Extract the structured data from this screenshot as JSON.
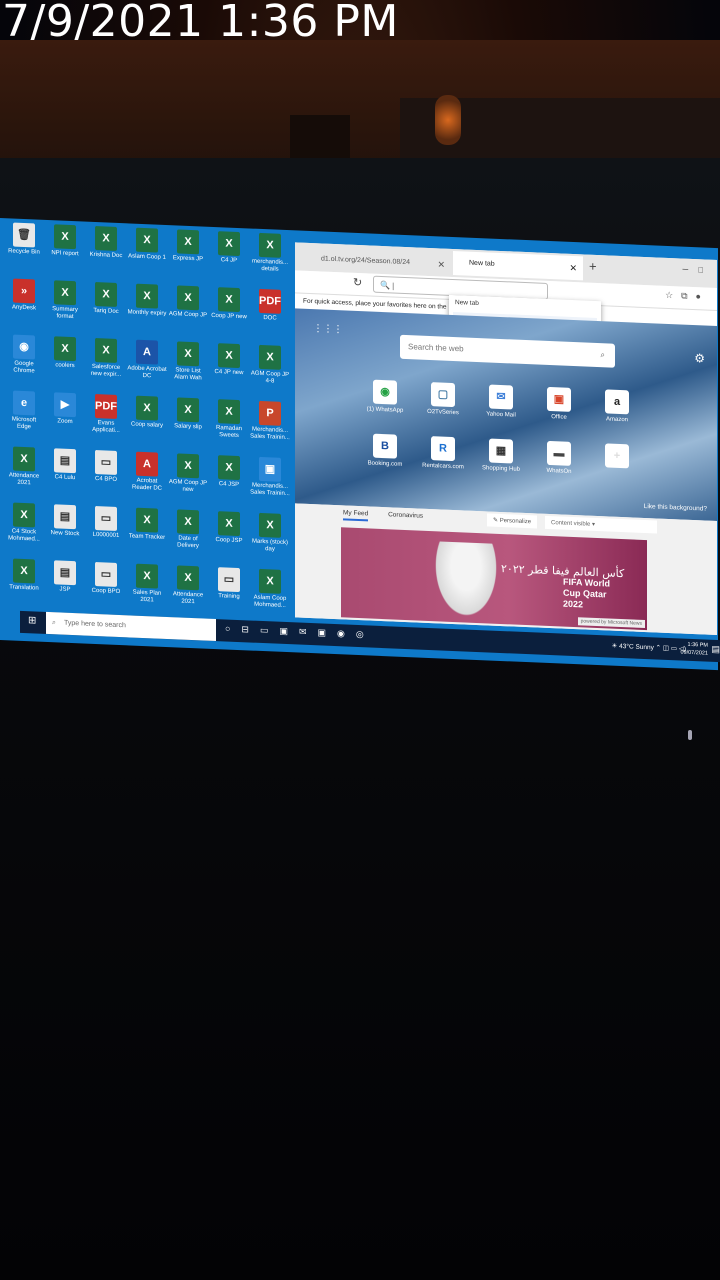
{
  "timestamp": "7/9/2021 1:36 PM",
  "desktop_icons": [
    {
      "label": "Recycle Bin",
      "kind": "w",
      "glyph": "🗑"
    },
    {
      "label": "NPI report",
      "kind": "x",
      "glyph": "X"
    },
    {
      "label": "Krishna Doc",
      "kind": "x",
      "glyph": "X"
    },
    {
      "label": "Aslam Coop 1",
      "kind": "x",
      "glyph": "X"
    },
    {
      "label": "Express JP",
      "kind": "x",
      "glyph": "X"
    },
    {
      "label": "C4 JP",
      "kind": "x",
      "glyph": "X"
    },
    {
      "label": "merchandis... details",
      "kind": "x",
      "glyph": "X"
    },
    {
      "label": "AnyDesk",
      "kind": "p",
      "glyph": "»"
    },
    {
      "label": "Summary format",
      "kind": "x",
      "glyph": "X"
    },
    {
      "label": "Tariq Doc",
      "kind": "x",
      "glyph": "X"
    },
    {
      "label": "Monthly expiry",
      "kind": "x",
      "glyph": "X"
    },
    {
      "label": "AGM Coop JP",
      "kind": "x",
      "glyph": "X"
    },
    {
      "label": "Coop JP new",
      "kind": "x",
      "glyph": "X"
    },
    {
      "label": "DOC",
      "kind": "p",
      "glyph": "PDF"
    },
    {
      "label": "Google Chrome",
      "kind": "e",
      "glyph": "◉"
    },
    {
      "label": "coolers",
      "kind": "x",
      "glyph": "X"
    },
    {
      "label": "Salesforce new expir...",
      "kind": "x",
      "glyph": "X"
    },
    {
      "label": "Adobe Acrobat DC",
      "kind": "b",
      "glyph": "A"
    },
    {
      "label": "Store List Alam Wah",
      "kind": "x",
      "glyph": "X"
    },
    {
      "label": "C4 JP new",
      "kind": "x",
      "glyph": "X"
    },
    {
      "label": "AGM Coop JP 4-8",
      "kind": "x",
      "glyph": "X"
    },
    {
      "label": "Microsoft Edge",
      "kind": "e",
      "glyph": "e"
    },
    {
      "label": "Zoom",
      "kind": "e",
      "glyph": "▶"
    },
    {
      "label": "Evans Applicati...",
      "kind": "p",
      "glyph": "PDF"
    },
    {
      "label": "Coop salary",
      "kind": "x",
      "glyph": "X"
    },
    {
      "label": "Salary slip",
      "kind": "x",
      "glyph": "X"
    },
    {
      "label": "Ramadan Sweets",
      "kind": "x",
      "glyph": "X"
    },
    {
      "label": "Merchandis... Sales Trainin...",
      "kind": "pp",
      "glyph": "P"
    },
    {
      "label": "Attendance 2021",
      "kind": "x",
      "glyph": "X"
    },
    {
      "label": "C4 Lulu",
      "kind": "w",
      "glyph": "▤"
    },
    {
      "label": "C4 BPO",
      "kind": "w",
      "glyph": "▭"
    },
    {
      "label": "Acrobat Reader DC",
      "kind": "p",
      "glyph": "A"
    },
    {
      "label": "AGM Coop JP new",
      "kind": "x",
      "glyph": "X"
    },
    {
      "label": "C4 JSP",
      "kind": "x",
      "glyph": "X"
    },
    {
      "label": "Merchandis... Sales Trainin...",
      "kind": "e",
      "glyph": "▣"
    },
    {
      "label": "C4 Stock Mohmaed...",
      "kind": "x",
      "glyph": "X"
    },
    {
      "label": "New Stock",
      "kind": "w",
      "glyph": "▤"
    },
    {
      "label": "L0000001",
      "kind": "w",
      "glyph": "▭"
    },
    {
      "label": "Team Tracker",
      "kind": "x",
      "glyph": "X"
    },
    {
      "label": "Date of Delivery",
      "kind": "x",
      "glyph": "X"
    },
    {
      "label": "Coop JSP",
      "kind": "x",
      "glyph": "X"
    },
    {
      "label": "Marks (stock) day",
      "kind": "x",
      "glyph": "X"
    },
    {
      "label": "Translation",
      "kind": "x",
      "glyph": "X"
    },
    {
      "label": "JSP",
      "kind": "w",
      "glyph": "▤"
    },
    {
      "label": "Coop BPO",
      "kind": "w",
      "glyph": "▭"
    },
    {
      "label": "Sales Plan 2021",
      "kind": "x",
      "glyph": "X"
    },
    {
      "label": "Attendance 2021",
      "kind": "x",
      "glyph": "X"
    },
    {
      "label": "Training",
      "kind": "w",
      "glyph": "▭"
    },
    {
      "label": "Aslam Coop Mohmaed...",
      "kind": "x",
      "glyph": "X"
    }
  ],
  "browser": {
    "tab1_title": "d1.ol.tv.org/24/Season.08/24",
    "tab2_title": "New tab",
    "new_tab_glyph": "+",
    "dropdown_title": "New tab",
    "dropdown_url": "edge://newtab",
    "favorites_hint": "For quick access, place your favorites here on the",
    "search_placeholder": "Search the web",
    "tiles": [
      {
        "name": "(1) WhatsApp",
        "glyph": "◉",
        "color": "#25a244"
      },
      {
        "name": "O2TvSeries",
        "glyph": "▢",
        "color": "#4a7fa8"
      },
      {
        "name": "Yahoo Mail",
        "glyph": "✉",
        "color": "#3d7fd8"
      },
      {
        "name": "Office",
        "glyph": "▣",
        "color": "#d8452a"
      },
      {
        "name": "Amazon",
        "glyph": "a",
        "color": "#222222"
      },
      {
        "name": "Booking.com",
        "glyph": "B",
        "color": "#1b4fa0"
      },
      {
        "name": "Rentalcars.com",
        "glyph": "R",
        "color": "#1b6fd0"
      },
      {
        "name": "Shopping Hub",
        "glyph": "▦",
        "color": "#333333"
      },
      {
        "name": "WhatsOn",
        "glyph": "▬",
        "color": "#444444"
      },
      {
        "name": "",
        "glyph": "+",
        "color": "#dddddd"
      }
    ],
    "like_bg": "Like this background?",
    "feed_tabs": [
      "My Feed",
      "Coronavirus"
    ],
    "personalize": "Personalize",
    "content_visible": "Content visible",
    "card_arabic": "كأس العالم فيفا قطر ٢٠٢٢",
    "card_title_1": "FIFA World",
    "card_title_2": "Cup Qatar",
    "card_title_3": "2022",
    "powered_by": "powered by Microsoft News"
  },
  "taskbar": {
    "search_placeholder": "Type here to search",
    "weather": "43°C  Sunny",
    "time": "1:36 PM",
    "date": "09/07/2021"
  }
}
